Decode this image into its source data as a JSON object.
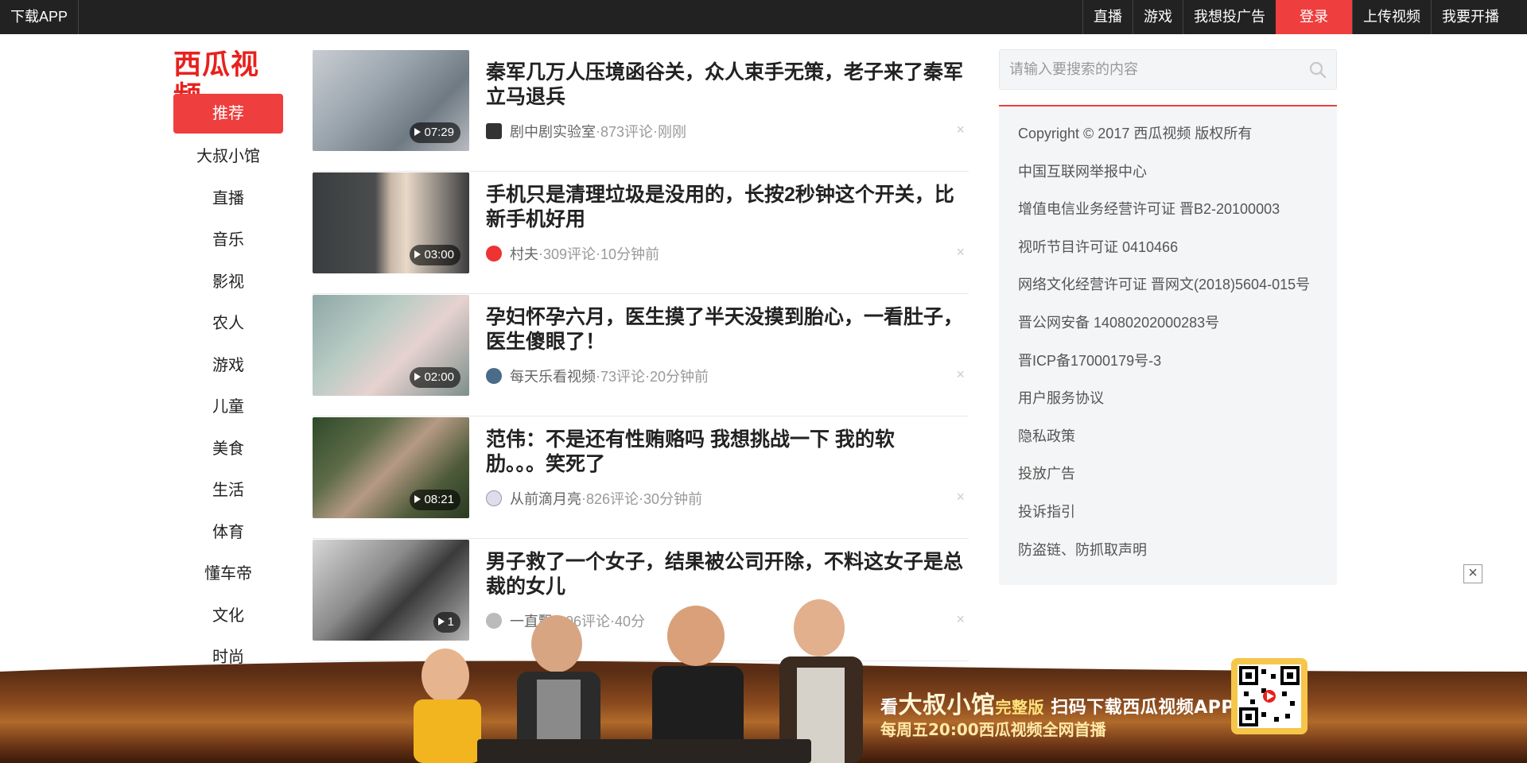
{
  "topbar": {
    "download_app": "下载APP",
    "links": [
      "直播",
      "游戏",
      "我想投广告"
    ],
    "login": "登录",
    "upload": "上传视频",
    "broadcast": "我要开播"
  },
  "logo": {
    "text": "西瓜视频"
  },
  "sidenav": {
    "active": "推荐",
    "items": [
      "大叔小馆",
      "直播",
      "音乐",
      "影视",
      "农人",
      "游戏",
      "儿童",
      "美食",
      "生活",
      "体育",
      "懂车帝",
      "文化",
      "时尚"
    ]
  },
  "feed": [
    {
      "title": "秦军几万人压境函谷关，众人束手无策，老子来了秦军立马退兵",
      "duration": "07:29",
      "author": "剧中剧实验室",
      "comments": "873评论",
      "time": "刚刚",
      "dislike": "×"
    },
    {
      "title": "手机只是清理垃圾是没用的，长按2秒钟这个开关，比新手机好用",
      "duration": "03:00",
      "author": "村夫",
      "comments": "309评论",
      "time": "10分钟前",
      "dislike": "×"
    },
    {
      "title": "孕妇怀孕六月，医生摸了半天没摸到胎心，一看肚子，医生傻眼了！",
      "duration": "02:00",
      "author": "每天乐看视频",
      "comments": "73评论",
      "time": "20分钟前",
      "dislike": "×"
    },
    {
      "title": "范伟：不是还有性贿赂吗 我想挑战一下 我的软肋。。。笑死了",
      "duration": "08:21",
      "author": "从前滴月亮",
      "comments": "826评论",
      "time": "30分钟前",
      "dislike": "×"
    },
    {
      "title": "男子救了一个女子，结果被公司开除，不料这女子是总裁的女儿",
      "duration": "1",
      "author": "一直飘",
      "comments": "106评论",
      "time": "40分",
      "dislike": "×"
    }
  ],
  "meta_sep": " · ",
  "search": {
    "placeholder": "请输入要搜索的内容"
  },
  "footer_links": [
    "Copyright © 2017 西瓜视频 版权所有",
    "中国互联网举报中心",
    "增值电信业务经营许可证 晋B2-20100003",
    "视听节目许可证 0410466",
    "网络文化经营许可证 晋网文(2018)5604-015号",
    "晋公网安备 14080202000283号",
    "晋ICP备17000179号-3",
    "用户服务协议",
    "隐私政策",
    "投放广告",
    "投诉指引",
    "防盗链、防抓取声明"
  ],
  "ad": {
    "close": "×",
    "line1_a": "看",
    "line1_b": "大叔小馆",
    "line1_c": "完整版",
    "line1_d": "扫码下载西瓜视频APP",
    "line2": "每周五20:00西瓜视频全网首播"
  },
  "colors": {
    "accent": "#ee3e3e",
    "topbar": "#222222",
    "logo": "#e8211d"
  }
}
